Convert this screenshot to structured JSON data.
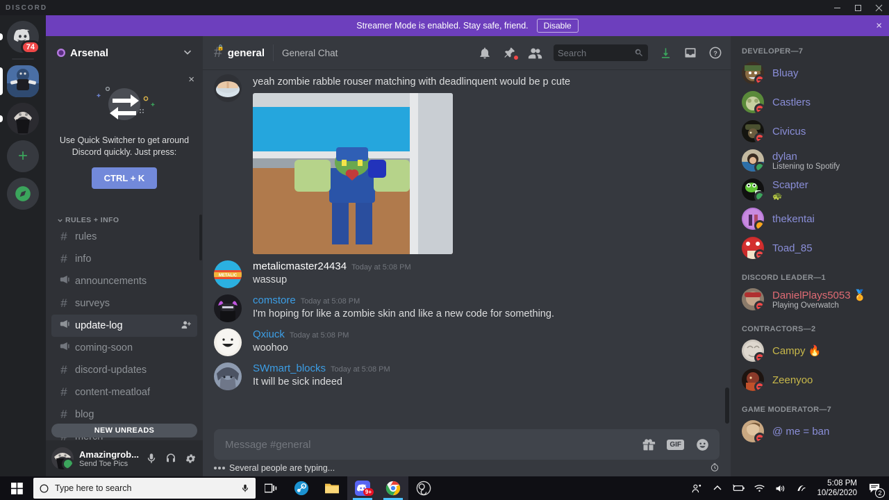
{
  "window": {
    "brand": "DISCORD",
    "minimize": "minimize-button",
    "maximize": "maximize-button",
    "close": "close-button"
  },
  "streamer_banner": {
    "message": "Streamer Mode is enabled. Stay safe, friend.",
    "disable_label": "Disable",
    "close": "×",
    "bg": "#6d3fbd"
  },
  "server_rail": {
    "home_badge": "74",
    "add_server_glyph": "+",
    "explore_glyph": "◉"
  },
  "sidebar": {
    "server_name": "Arsenal",
    "quick_switcher": {
      "text": "Use Quick Switcher to get around Discord quickly. Just press:",
      "key_label": "CTRL + K",
      "close": "×"
    },
    "category": "RULES + INFO",
    "channels": [
      {
        "name": "rules",
        "type": "text",
        "active": false
      },
      {
        "name": "info",
        "type": "text",
        "active": false
      },
      {
        "name": "announcements",
        "type": "announcement",
        "active": false
      },
      {
        "name": "surveys",
        "type": "text",
        "active": false
      },
      {
        "name": "update-log",
        "type": "announcement",
        "active": true
      },
      {
        "name": "coming-soon",
        "type": "announcement",
        "active": false
      },
      {
        "name": "discord-updates",
        "type": "text",
        "active": false
      },
      {
        "name": "content-meatloaf",
        "type": "text",
        "active": false
      },
      {
        "name": "blog",
        "type": "text",
        "active": false
      },
      {
        "name": "merch",
        "type": "text",
        "active": false
      }
    ],
    "new_unreads_label": "NEW UNREADS",
    "user": {
      "name": "Amazingrob...",
      "status_text": "Send Toe Pics",
      "status": "online",
      "mic": "microphone-icon",
      "headset": "headset-icon",
      "settings": "gear-icon"
    }
  },
  "chat": {
    "channel_name": "general",
    "topic": "General Chat",
    "search_placeholder": "Search",
    "messages": [
      {
        "author": "",
        "timestamp": "",
        "text": "yeah zombie rabble rouser matching with deadlinquent would be p cute",
        "continuation": true,
        "attachment": true,
        "color": "#ffffff"
      },
      {
        "author": "metalicmaster24434",
        "timestamp": "Today at 5:08 PM",
        "text": "wassup",
        "continuation": false,
        "attachment": false,
        "color": "#ffffff"
      },
      {
        "author": "comstore",
        "timestamp": "Today at 5:08 PM",
        "text": "I'm hoping for like a zombie skin and like a new code for something.",
        "continuation": false,
        "attachment": false,
        "color": "#3c9ee5"
      },
      {
        "author": "Qxiuck",
        "timestamp": "Today at 5:08 PM",
        "text": "woohoo",
        "continuation": false,
        "attachment": false,
        "color": "#3c9ee5"
      },
      {
        "author": "SWmart_blocks",
        "timestamp": "Today at 5:08 PM",
        "text": "It will be sick indeed",
        "continuation": false,
        "attachment": false,
        "color": "#3c9ee5"
      }
    ],
    "composer_placeholder": "Message #general",
    "typing_text": "Several people are typing...",
    "icons": {
      "notification": "bell-icon",
      "pinned": "pin-icon",
      "members": "members-icon",
      "inbox": "inbox-icon",
      "help": "help-icon",
      "download": "download-icon",
      "gift": "gift-icon",
      "gif": "GIF",
      "emoji": "emoji-icon"
    }
  },
  "members": {
    "groups": [
      {
        "label": "DEVELOPER—7",
        "members": [
          {
            "name": "Bluay",
            "status": "dnd",
            "sub": "",
            "color": "#8a8ed8"
          },
          {
            "name": "Castlers",
            "status": "dnd",
            "sub": "",
            "color": "#8a8ed8"
          },
          {
            "name": "Civicus",
            "status": "dnd",
            "sub": "",
            "color": "#8a8ed8"
          },
          {
            "name": "dylan",
            "status": "online",
            "sub": "Listening to Spotify",
            "color": "#8a8ed8"
          },
          {
            "name": "Scapter",
            "status": "mobile",
            "sub": "🐢",
            "color": "#8a8ed8"
          },
          {
            "name": "thekentai",
            "status": "idle",
            "sub": "",
            "color": "#8a8ed8"
          },
          {
            "name": "Toad_85",
            "status": "dnd",
            "sub": "",
            "color": "#8a8ed8"
          }
        ]
      },
      {
        "label": "DISCORD LEADER—1",
        "members": [
          {
            "name": "DanielPlays5053 🏅",
            "status": "dnd",
            "sub": "Playing Overwatch",
            "color": "#e06b74"
          }
        ]
      },
      {
        "label": "CONTRACTORS—2",
        "members": [
          {
            "name": "Campy 🔥",
            "status": "dnd",
            "sub": "",
            "color": "#c8b84a"
          },
          {
            "name": "Zeenyoo",
            "status": "dnd",
            "sub": "",
            "color": "#c8b84a"
          }
        ]
      },
      {
        "label": "GAME MODERATOR—7",
        "members": [
          {
            "name": "@ me = ban",
            "status": "dnd",
            "sub": "",
            "color": "#8a8ed8"
          }
        ]
      }
    ]
  },
  "taskbar": {
    "search_placeholder": "Type here to search",
    "start": "windows-start-icon",
    "mic": "microphone-icon",
    "task_view": "task-view-icon",
    "apps": [
      {
        "name": "steam",
        "badge": "",
        "open": false
      },
      {
        "name": "file-explorer",
        "badge": "",
        "open": false
      },
      {
        "name": "discord",
        "badge": "9+",
        "open": true
      },
      {
        "name": "chrome",
        "badge": "",
        "open": true
      },
      {
        "name": "obs",
        "badge": "",
        "open": false
      }
    ],
    "time": "5:08 PM",
    "date": "10/26/2020",
    "notification_count": "2"
  }
}
